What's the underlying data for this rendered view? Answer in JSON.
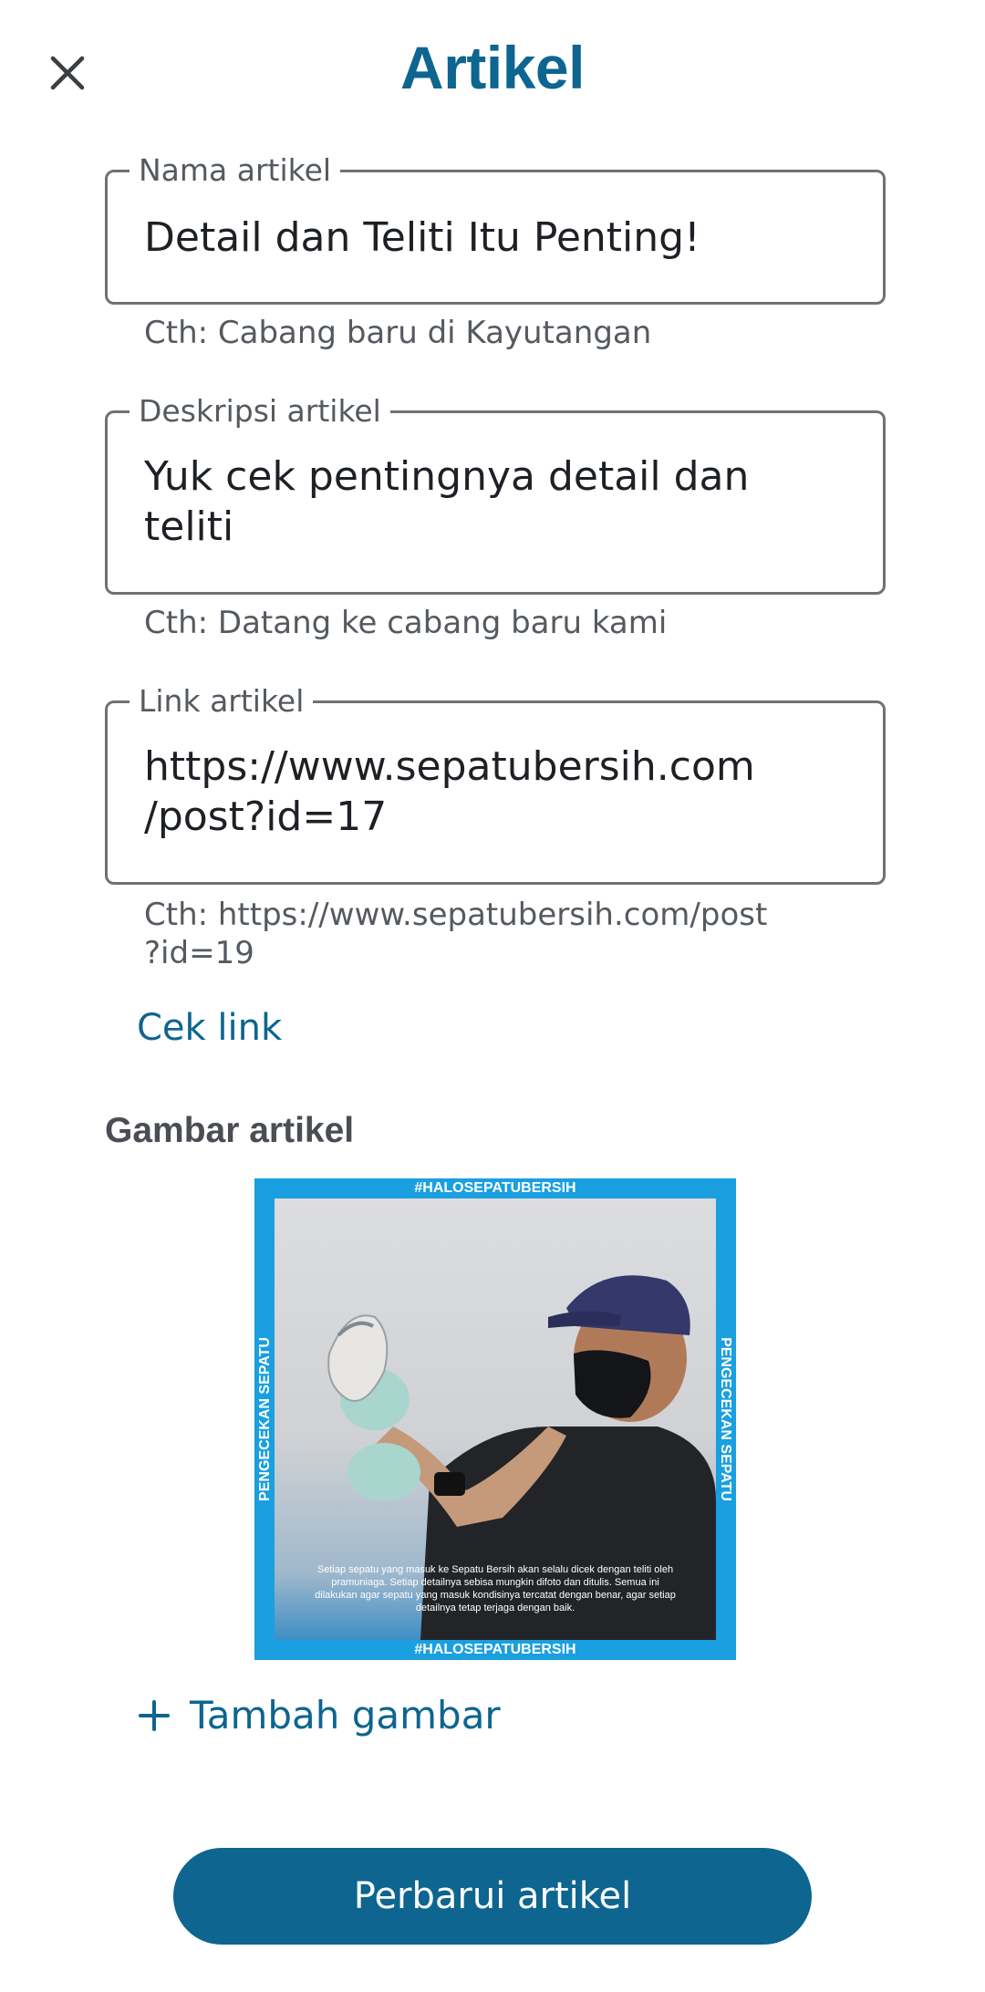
{
  "header": {
    "title": "Artikel",
    "close_icon": "close-icon"
  },
  "form": {
    "name": {
      "label": "Nama artikel",
      "value": "Detail dan Teliti Itu Penting!",
      "helper": "Cth: Cabang baru di Kayutangan"
    },
    "description": {
      "label": "Deskripsi artikel",
      "value": "Yuk cek pentingnya detail dan\nteliti",
      "helper": "Cth: Datang ke cabang baru kami"
    },
    "link": {
      "label": "Link artikel",
      "value": "https://www.sepatubersih.com\n/post?id=17",
      "helper": "Cth: https://www.sepatubersih.com/post\n?id=19",
      "check_label": "Cek link"
    },
    "image": {
      "section_label": "Gambar artikel",
      "top_banner": "#HALOSEPATUBERSIH",
      "bottom_banner": "#HALOSEPATUBERSIH",
      "side_text_left": "PENGECEKAN SEPATU",
      "side_text_right": "PENGECEKAN SEPATU",
      "caption": "Setiap sepatu yang masuk ke Sepatu Bersih akan selalu dicek dengan teliti oleh pramuniaga. Setiap detailnya sebisa mungkin difoto dan ditulis. Semua ini dilakukan agar sepatu yang masuk kondisinya tercatat dengan benar, agar setiap detailnya tetap terjaga dengan baik.",
      "add_label": "Tambah gambar",
      "add_icon": "plus-icon"
    }
  },
  "actions": {
    "submit_label": "Perbarui artikel"
  },
  "colors": {
    "primary": "#0d6590",
    "image_frame": "#1a9fe0",
    "outline": "#6e7277"
  }
}
